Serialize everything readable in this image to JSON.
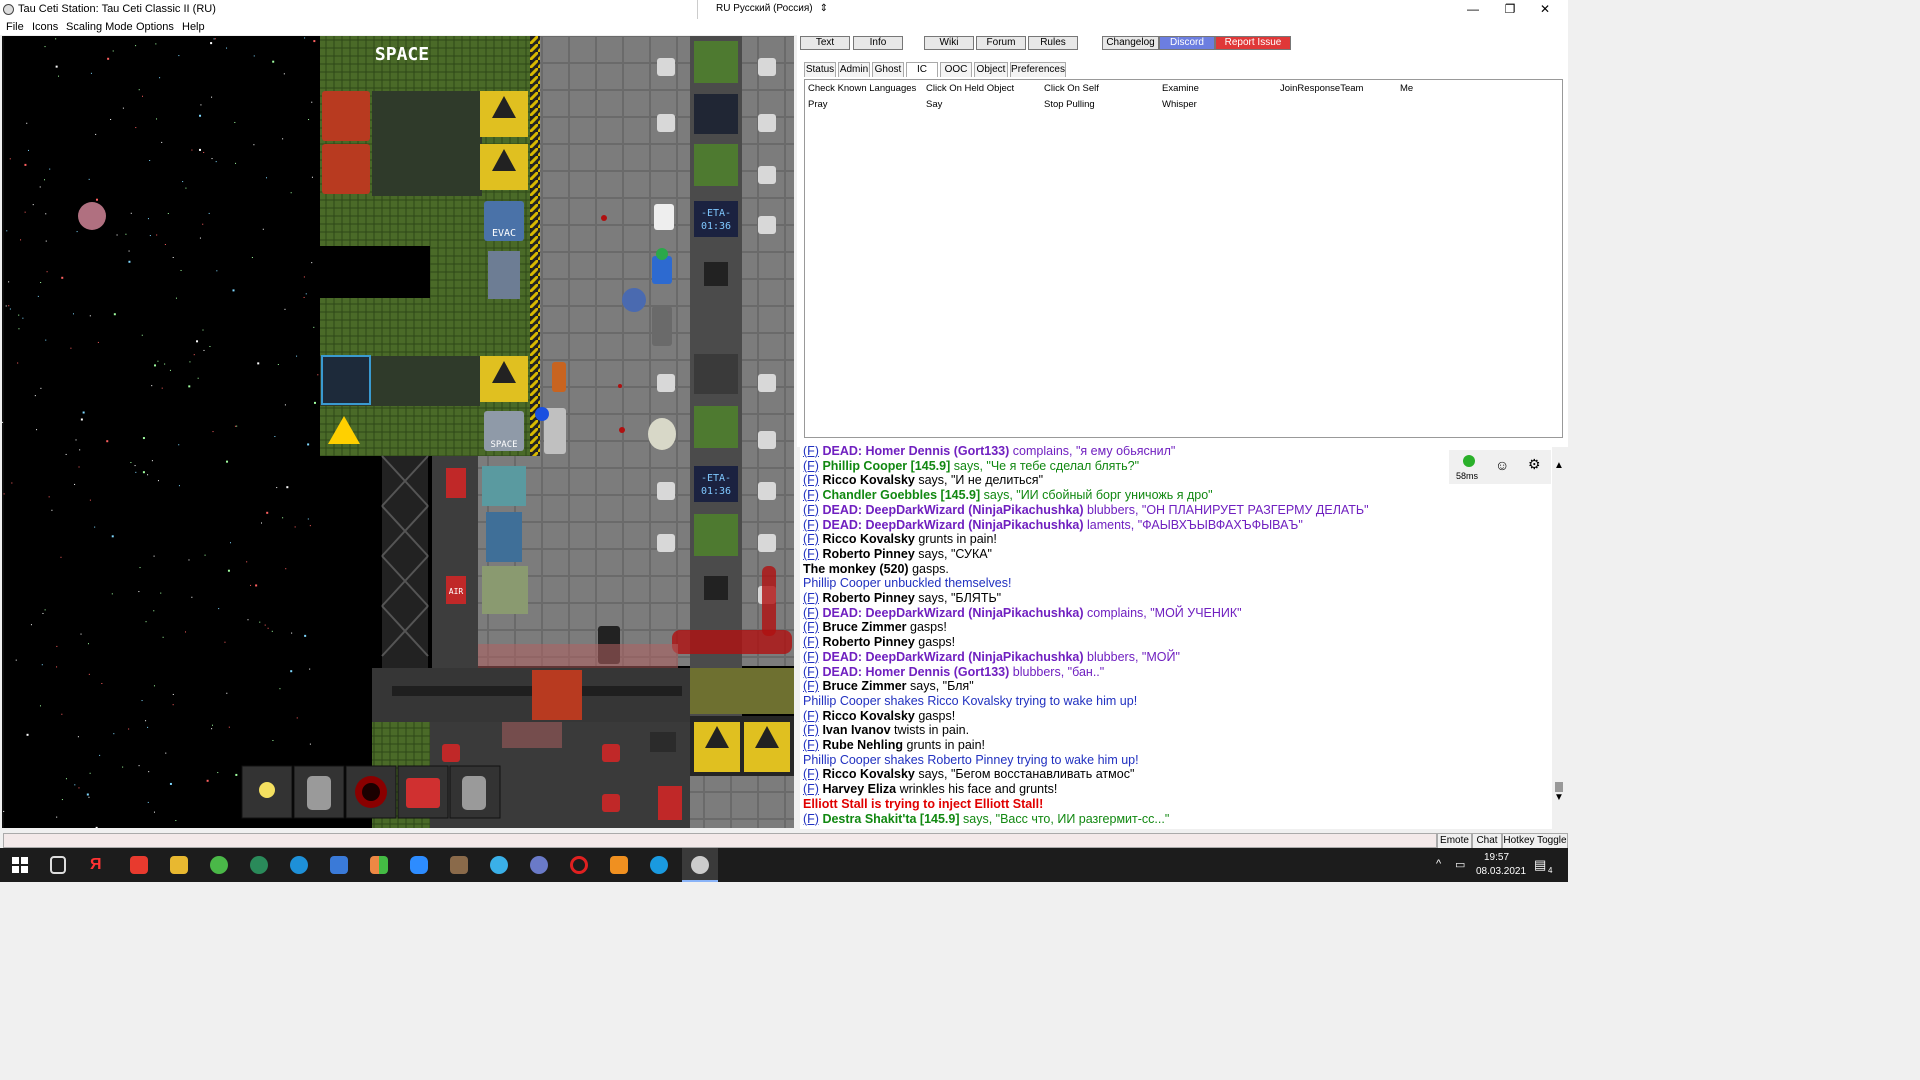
{
  "window": {
    "title": "Tau Ceti Station: Tau Ceti Classic II (RU)",
    "language": "RU Русский (Россия)"
  },
  "menu": [
    "File",
    "Icons",
    "Scaling Mode",
    "Options",
    "Help"
  ],
  "game": {
    "area_sign": "SPACE",
    "signs": {
      "evac": "EVAC",
      "space": "SPACE",
      "eta_label": "-ETA-",
      "eta_time": "01:36",
      "airlock": "AIR"
    }
  },
  "top_buttons": [
    "Text",
    "Info",
    "Wiki",
    "Forum",
    "Rules",
    "Changelog",
    "Discord",
    "Report Issue"
  ],
  "tabs": [
    "Status",
    "Admin",
    "Ghost",
    "IC",
    "OOC",
    "Object",
    "Preferences"
  ],
  "verbs": [
    [
      "Check Known Languages",
      "Click On Held Object",
      "Click On Self",
      "Examine",
      "JoinResponseTeam",
      "Me"
    ],
    [
      "Pray",
      "Say",
      "Stop Pulling",
      "Whisper"
    ]
  ],
  "ping": "58ms",
  "chat": [
    {
      "f": true,
      "n": "DEAD: Homer Dennis (Gort133)",
      "t": " complains, \"я ему обьяснил\"",
      "c": "#7020c0",
      "nc": "#7020c0"
    },
    {
      "f": true,
      "n": "Phillip Cooper [145.9]",
      "t": " says, \"Че я тебе сделал блять?\"",
      "c": "#118811",
      "nc": "#118811"
    },
    {
      "f": true,
      "n": "Ricco Kovalsky",
      "t": " says, \"И не делиться\"",
      "c": "#000",
      "nc": "#000"
    },
    {
      "f": true,
      "n": "Chandler Goebbles [145.9]",
      "t": " says, \"ИИ сбойный борг уничожь я дро\"",
      "c": "#118811",
      "nc": "#118811"
    },
    {
      "f": true,
      "n": "DEAD: DeepDarkWizard (NinjaPikachushka)",
      "t": " blubbers, \"ОН ПЛАНИРУЕТ РАЗГЕРМУ ДЕЛАТЬ\"",
      "c": "#7020c0",
      "nc": "#7020c0"
    },
    {
      "f": true,
      "n": "DEAD: DeepDarkWizard (NinjaPikachushka)",
      "t": " laments, \"ФАЫВХЪЫВФАХЪФЫВАЪ\"",
      "c": "#7020c0",
      "nc": "#7020c0"
    },
    {
      "f": true,
      "n": "Ricco Kovalsky",
      "t": " grunts in pain!",
      "c": "#000",
      "nc": "#000"
    },
    {
      "f": true,
      "n": "Roberto Pinney",
      "t": " says, \"СУКА\"",
      "c": "#000",
      "nc": "#000"
    },
    {
      "f": false,
      "n": "The monkey (520)",
      "t": " gasps.",
      "c": "#000",
      "nc": "#000"
    },
    {
      "f": false,
      "n": "",
      "t": "Phillip Cooper unbuckled themselves!",
      "c": "#2030c0",
      "nc": "#2030c0"
    },
    {
      "f": true,
      "n": "Roberto Pinney",
      "t": " says, \"БЛЯТЬ\"",
      "c": "#000",
      "nc": "#000"
    },
    {
      "f": true,
      "n": "DEAD: DeepDarkWizard (NinjaPikachushka)",
      "t": " complains, \"МОЙ УЧЕНИК\"",
      "c": "#7020c0",
      "nc": "#7020c0"
    },
    {
      "f": true,
      "n": "Bruce Zimmer",
      "t": " gasps!",
      "c": "#000",
      "nc": "#000"
    },
    {
      "f": true,
      "n": "Roberto Pinney",
      "t": " gasps!",
      "c": "#000",
      "nc": "#000"
    },
    {
      "f": true,
      "n": "DEAD: DeepDarkWizard (NinjaPikachushka)",
      "t": " blubbers, \"МОЙ\"",
      "c": "#7020c0",
      "nc": "#7020c0"
    },
    {
      "f": true,
      "n": "DEAD: Homer Dennis (Gort133)",
      "t": " blubbers, \"бан..\"",
      "c": "#7020c0",
      "nc": "#7020c0"
    },
    {
      "f": true,
      "n": "Bruce Zimmer",
      "t": " says, \"Бля\"",
      "c": "#000",
      "nc": "#000"
    },
    {
      "f": false,
      "n": "",
      "t": "Phillip Cooper shakes Ricco Kovalsky trying to wake him up!",
      "c": "#2030c0",
      "nc": "#2030c0"
    },
    {
      "f": true,
      "n": "Ricco Kovalsky",
      "t": " gasps!",
      "c": "#000",
      "nc": "#000"
    },
    {
      "f": true,
      "n": "Ivan Ivanov",
      "t": " twists in pain.",
      "c": "#000",
      "nc": "#000"
    },
    {
      "f": true,
      "n": "Rube Nehling",
      "t": " grunts in pain!",
      "c": "#000",
      "nc": "#000"
    },
    {
      "f": false,
      "n": "",
      "t": "Phillip Cooper shakes Roberto Pinney trying to wake him up!",
      "c": "#2030c0",
      "nc": "#2030c0"
    },
    {
      "f": true,
      "n": "Ricco Kovalsky",
      "t": " says, \"Бегом восстанавливать атмос\"",
      "c": "#000",
      "nc": "#000"
    },
    {
      "f": true,
      "n": "Harvey Eliza",
      "t": " wrinkles his face and grunts!",
      "c": "#000",
      "nc": "#000"
    },
    {
      "f": false,
      "n": "",
      "t": "Elliott Stall is trying to inject Elliott Stall!",
      "c": "#e00000",
      "nc": "#e00000",
      "bold": true
    },
    {
      "f": true,
      "n": "Destra Shakit'ta [145.9]",
      "t": " says, \"Васс что, ИИ разгермит-сс...\"",
      "c": "#118811",
      "nc": "#118811"
    }
  ],
  "bottom_buttons": [
    "Emote",
    "Chat",
    "Hotkey Toggle"
  ],
  "taskbar": {
    "time": "19:57",
    "date": "08.03.2021",
    "notifications": "4"
  }
}
